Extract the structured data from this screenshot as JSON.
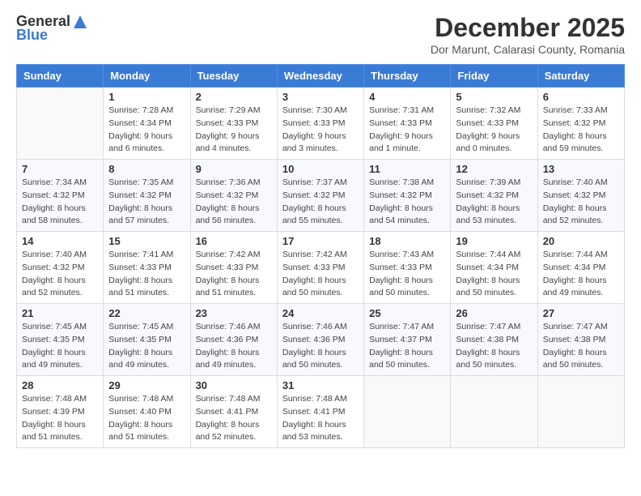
{
  "logo": {
    "general": "General",
    "blue": "Blue"
  },
  "title": {
    "month_year": "December 2025",
    "subtitle": "Dor Marunt, Calarasi County, Romania"
  },
  "headers": [
    "Sunday",
    "Monday",
    "Tuesday",
    "Wednesday",
    "Thursday",
    "Friday",
    "Saturday"
  ],
  "weeks": [
    [
      {
        "day": "",
        "info": ""
      },
      {
        "day": "1",
        "info": "Sunrise: 7:28 AM\nSunset: 4:34 PM\nDaylight: 9 hours\nand 6 minutes."
      },
      {
        "day": "2",
        "info": "Sunrise: 7:29 AM\nSunset: 4:33 PM\nDaylight: 9 hours\nand 4 minutes."
      },
      {
        "day": "3",
        "info": "Sunrise: 7:30 AM\nSunset: 4:33 PM\nDaylight: 9 hours\nand 3 minutes."
      },
      {
        "day": "4",
        "info": "Sunrise: 7:31 AM\nSunset: 4:33 PM\nDaylight: 9 hours\nand 1 minute."
      },
      {
        "day": "5",
        "info": "Sunrise: 7:32 AM\nSunset: 4:33 PM\nDaylight: 9 hours\nand 0 minutes."
      },
      {
        "day": "6",
        "info": "Sunrise: 7:33 AM\nSunset: 4:32 PM\nDaylight: 8 hours\nand 59 minutes."
      }
    ],
    [
      {
        "day": "7",
        "info": "Sunrise: 7:34 AM\nSunset: 4:32 PM\nDaylight: 8 hours\nand 58 minutes."
      },
      {
        "day": "8",
        "info": "Sunrise: 7:35 AM\nSunset: 4:32 PM\nDaylight: 8 hours\nand 57 minutes."
      },
      {
        "day": "9",
        "info": "Sunrise: 7:36 AM\nSunset: 4:32 PM\nDaylight: 8 hours\nand 56 minutes."
      },
      {
        "day": "10",
        "info": "Sunrise: 7:37 AM\nSunset: 4:32 PM\nDaylight: 8 hours\nand 55 minutes."
      },
      {
        "day": "11",
        "info": "Sunrise: 7:38 AM\nSunset: 4:32 PM\nDaylight: 8 hours\nand 54 minutes."
      },
      {
        "day": "12",
        "info": "Sunrise: 7:39 AM\nSunset: 4:32 PM\nDaylight: 8 hours\nand 53 minutes."
      },
      {
        "day": "13",
        "info": "Sunrise: 7:40 AM\nSunset: 4:32 PM\nDaylight: 8 hours\nand 52 minutes."
      }
    ],
    [
      {
        "day": "14",
        "info": "Sunrise: 7:40 AM\nSunset: 4:32 PM\nDaylight: 8 hours\nand 52 minutes."
      },
      {
        "day": "15",
        "info": "Sunrise: 7:41 AM\nSunset: 4:33 PM\nDaylight: 8 hours\nand 51 minutes."
      },
      {
        "day": "16",
        "info": "Sunrise: 7:42 AM\nSunset: 4:33 PM\nDaylight: 8 hours\nand 51 minutes."
      },
      {
        "day": "17",
        "info": "Sunrise: 7:42 AM\nSunset: 4:33 PM\nDaylight: 8 hours\nand 50 minutes."
      },
      {
        "day": "18",
        "info": "Sunrise: 7:43 AM\nSunset: 4:33 PM\nDaylight: 8 hours\nand 50 minutes."
      },
      {
        "day": "19",
        "info": "Sunrise: 7:44 AM\nSunset: 4:34 PM\nDaylight: 8 hours\nand 50 minutes."
      },
      {
        "day": "20",
        "info": "Sunrise: 7:44 AM\nSunset: 4:34 PM\nDaylight: 8 hours\nand 49 minutes."
      }
    ],
    [
      {
        "day": "21",
        "info": "Sunrise: 7:45 AM\nSunset: 4:35 PM\nDaylight: 8 hours\nand 49 minutes."
      },
      {
        "day": "22",
        "info": "Sunrise: 7:45 AM\nSunset: 4:35 PM\nDaylight: 8 hours\nand 49 minutes."
      },
      {
        "day": "23",
        "info": "Sunrise: 7:46 AM\nSunset: 4:36 PM\nDaylight: 8 hours\nand 49 minutes."
      },
      {
        "day": "24",
        "info": "Sunrise: 7:46 AM\nSunset: 4:36 PM\nDaylight: 8 hours\nand 50 minutes."
      },
      {
        "day": "25",
        "info": "Sunrise: 7:47 AM\nSunset: 4:37 PM\nDaylight: 8 hours\nand 50 minutes."
      },
      {
        "day": "26",
        "info": "Sunrise: 7:47 AM\nSunset: 4:38 PM\nDaylight: 8 hours\nand 50 minutes."
      },
      {
        "day": "27",
        "info": "Sunrise: 7:47 AM\nSunset: 4:38 PM\nDaylight: 8 hours\nand 50 minutes."
      }
    ],
    [
      {
        "day": "28",
        "info": "Sunrise: 7:48 AM\nSunset: 4:39 PM\nDaylight: 8 hours\nand 51 minutes."
      },
      {
        "day": "29",
        "info": "Sunrise: 7:48 AM\nSunset: 4:40 PM\nDaylight: 8 hours\nand 51 minutes."
      },
      {
        "day": "30",
        "info": "Sunrise: 7:48 AM\nSunset: 4:41 PM\nDaylight: 8 hours\nand 52 minutes."
      },
      {
        "day": "31",
        "info": "Sunrise: 7:48 AM\nSunset: 4:41 PM\nDaylight: 8 hours\nand 53 minutes."
      },
      {
        "day": "",
        "info": ""
      },
      {
        "day": "",
        "info": ""
      },
      {
        "day": "",
        "info": ""
      }
    ]
  ]
}
